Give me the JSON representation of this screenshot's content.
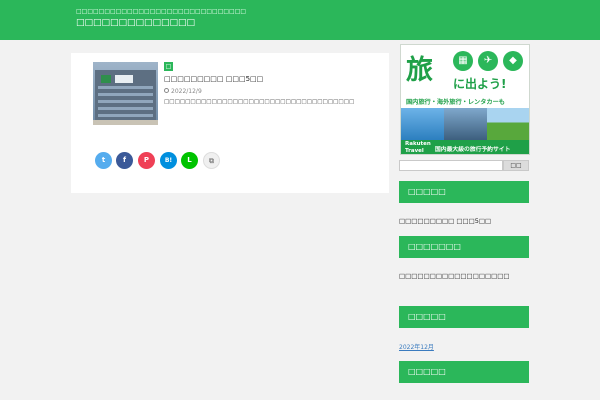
{
  "header": {
    "tagline": "□□□□□□□□□□□□□□□□□□□□□□□□□□□□□□",
    "site_title": "□□□□□□□□□□□□□□"
  },
  "post": {
    "category": "□",
    "title": "□□□□□□□□□ □□□5□□",
    "date": "2022/12/9",
    "excerpt": "□□□□□□□□□□□□□□□□□□□□□□□□□□□□□□□□□□□□"
  },
  "share": {
    "twitter": "t",
    "facebook": "f",
    "pocket": "P",
    "hatena": "B!",
    "line": "L",
    "copy": "⧉"
  },
  "ad": {
    "headline": "旅",
    "headline_rest": "に出よう!",
    "sub": "国内旅行・海外旅行・レンタカーも",
    "brand": "Rakuten Travel",
    "footer": "国内最大級の旅行予約サイト"
  },
  "search": {
    "button": "□□"
  },
  "widgets": {
    "recent_title": "□□□□□",
    "recent_item": "□□□□□□□□□ □□□5□□",
    "comments_title": "□□□□□□□",
    "comments_item": "□□□□□□□□□□□□□□□□□□",
    "archive_title": "□□□□□",
    "archive_item": "2022年12月",
    "category_title": "□□□□□"
  },
  "icons": [
    "building-icon",
    "airplane-icon",
    "car-icon",
    "clock-icon",
    "copy-icon"
  ],
  "colors": {
    "accent": "#2bb75a",
    "background": "#f2f2f2"
  }
}
